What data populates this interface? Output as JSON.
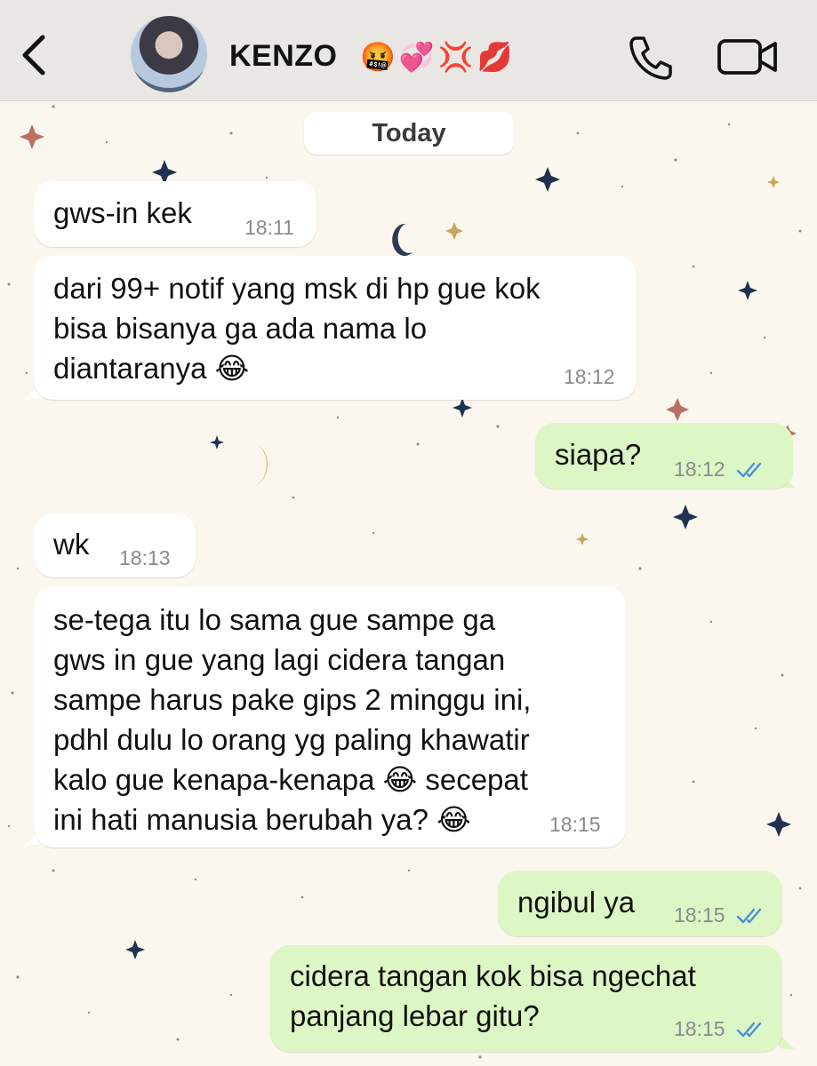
{
  "header": {
    "contact_name": "KENZO",
    "name_emojis": [
      "🤬",
      "💞",
      "💢",
      "💋"
    ],
    "icons": [
      "chevron-left-icon",
      "phone-icon",
      "video-camera-icon"
    ]
  },
  "date_separator": "Today",
  "messages": [
    {
      "direction": "in",
      "text": "gws-in kek",
      "time": "18:11"
    },
    {
      "direction": "in",
      "lines": [
        "dari 99+ notif yang msk di hp gue kok",
        "bisa bisanya ga ada nama lo",
        "diantaranya 😂"
      ],
      "time": "18:12"
    },
    {
      "direction": "out",
      "text": "siapa?",
      "time": "18:12",
      "status": "read"
    },
    {
      "direction": "in",
      "text": "wk",
      "time": "18:13"
    },
    {
      "direction": "in",
      "lines": [
        "se-tega itu lo sama gue sampe ga",
        "gws in gue yang lagi cidera tangan",
        "sampe harus pake gips 2 minggu ini,",
        "pdhl dulu lo orang yg paling khawatir",
        "kalo gue kenapa-kenapa 😂 secepat",
        "ini hati manusia berubah ya? 😂"
      ],
      "time": "18:15"
    },
    {
      "direction": "out",
      "text": "ngibul ya",
      "time": "18:15",
      "status": "read"
    },
    {
      "direction": "out",
      "lines": [
        "cidera tangan kok bisa ngechat",
        "panjang lebar gitu?"
      ],
      "time": "18:15",
      "status": "read"
    }
  ],
  "colors": {
    "header_bg": "#e9e7e3",
    "wallpaper_bg": "#fbf7ee",
    "incoming_bubble": "#ffffff",
    "outgoing_bubble": "#dcf7c5",
    "read_ticks": "#4a8fe0"
  }
}
